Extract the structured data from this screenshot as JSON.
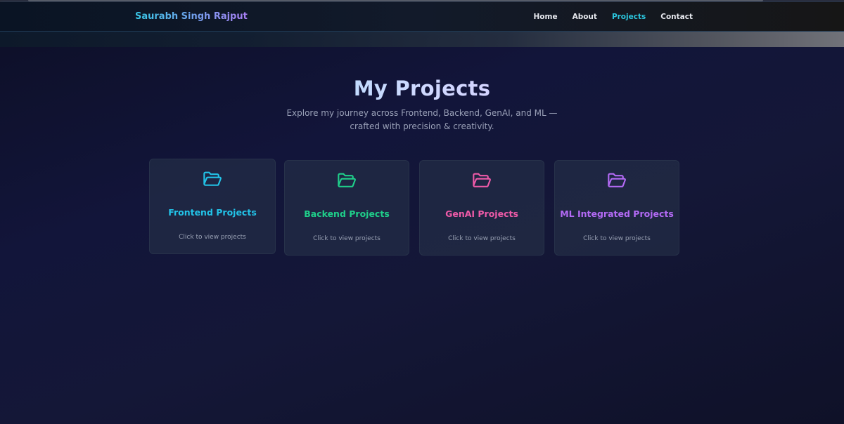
{
  "nav": {
    "brand": "Saurabh Singh Rajput",
    "links": [
      {
        "label": "Home",
        "active": false
      },
      {
        "label": "About",
        "active": false
      },
      {
        "label": "Projects",
        "active": true
      },
      {
        "label": "Contact",
        "active": false
      }
    ]
  },
  "hero": {
    "title": "My Projects",
    "subtitle": "Explore my journey across Frontend, Backend, GenAI, and ML — crafted with precision & creativity."
  },
  "cards": [
    {
      "title": "Frontend Projects",
      "subtitle": "Click to view projects",
      "color": "#22c3e8",
      "icon": "folder-open-icon"
    },
    {
      "title": "Backend Projects",
      "subtitle": "Click to view projects",
      "color": "#1fcf8a",
      "icon": "folder-open-icon"
    },
    {
      "title": "GenAI Projects",
      "subtitle": "Click to view projects",
      "color": "#ee5aa8",
      "icon": "folder-open-icon"
    },
    {
      "title": "ML Integrated Projects",
      "subtitle": "Click to view projects",
      "color": "#b36af5",
      "icon": "folder-open-icon"
    }
  ]
}
